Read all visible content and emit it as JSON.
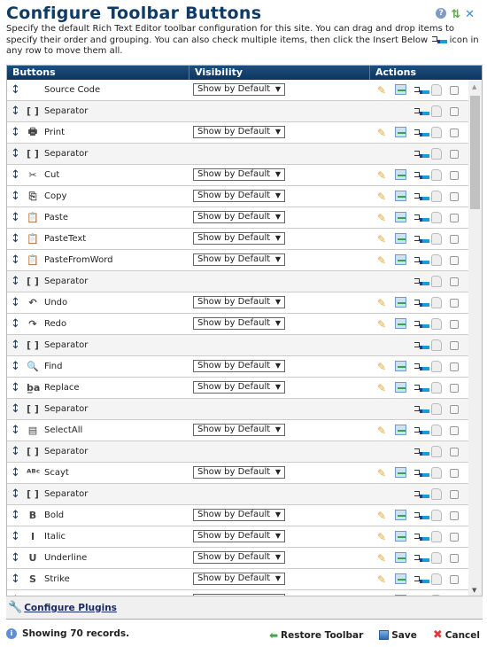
{
  "title": "Configure Toolbar Buttons",
  "description_pre": "Specify the default Rich Text Editor toolbar configuration for this site. You can drag and drop items to specify their order and grouping. You can also check multiple items, then click the Insert Below",
  "description_post": "icon in any row to move them all.",
  "columns": [
    "Buttons",
    "Visibility",
    "Actions"
  ],
  "rows": [
    {
      "name": "Source Code",
      "icon": "",
      "vis": "Show by Default"
    },
    {
      "name": "Separator",
      "icon": "[ ]",
      "sep": true
    },
    {
      "name": "Print",
      "icon": "🖶",
      "vis": "Show by Default"
    },
    {
      "name": "Separator",
      "icon": "[ ]",
      "sep": true
    },
    {
      "name": "Cut",
      "icon": "✂",
      "vis": "Show by Default"
    },
    {
      "name": "Copy",
      "icon": "⎘",
      "vis": "Show by Default"
    },
    {
      "name": "Paste",
      "icon": "📋",
      "vis": "Show by Default"
    },
    {
      "name": "PasteText",
      "icon": "📋",
      "vis": "Show by Default"
    },
    {
      "name": "PasteFromWord",
      "icon": "📋",
      "vis": "Show by Default"
    },
    {
      "name": "Separator",
      "icon": "[ ]",
      "sep": true
    },
    {
      "name": "Undo",
      "icon": "↶",
      "vis": "Show by Default"
    },
    {
      "name": "Redo",
      "icon": "↷",
      "vis": "Show by Default"
    },
    {
      "name": "Separator",
      "icon": "[ ]",
      "sep": true
    },
    {
      "name": "Find",
      "icon": "🔍",
      "vis": "Show by Default"
    },
    {
      "name": "Replace",
      "icon": "b̲a",
      "vis": "Show by Default"
    },
    {
      "name": "Separator",
      "icon": "[ ]",
      "sep": true
    },
    {
      "name": "SelectAll",
      "icon": "▤",
      "vis": "Show by Default"
    },
    {
      "name": "Separator",
      "icon": "[ ]",
      "sep": true
    },
    {
      "name": "Scayt",
      "icon": "ᴬᴮᶜ",
      "vis": "Show by Default"
    },
    {
      "name": "Separator",
      "icon": "[ ]",
      "sep": true
    },
    {
      "name": "Bold",
      "icon": "B",
      "vis": "Show by Default"
    },
    {
      "name": "Italic",
      "icon": "I",
      "vis": "Show by Default"
    },
    {
      "name": "Underline",
      "icon": "U",
      "vis": "Show by Default"
    },
    {
      "name": "Strike",
      "icon": "S",
      "vis": "Show by Default"
    },
    {
      "name": "",
      "icon": "",
      "vis": ""
    }
  ],
  "configure_plugins": "Configure Plugins",
  "status": "Showing 70 records.",
  "buttons": {
    "restore": "Restore Toolbar",
    "save": "Save",
    "cancel": "Cancel"
  }
}
